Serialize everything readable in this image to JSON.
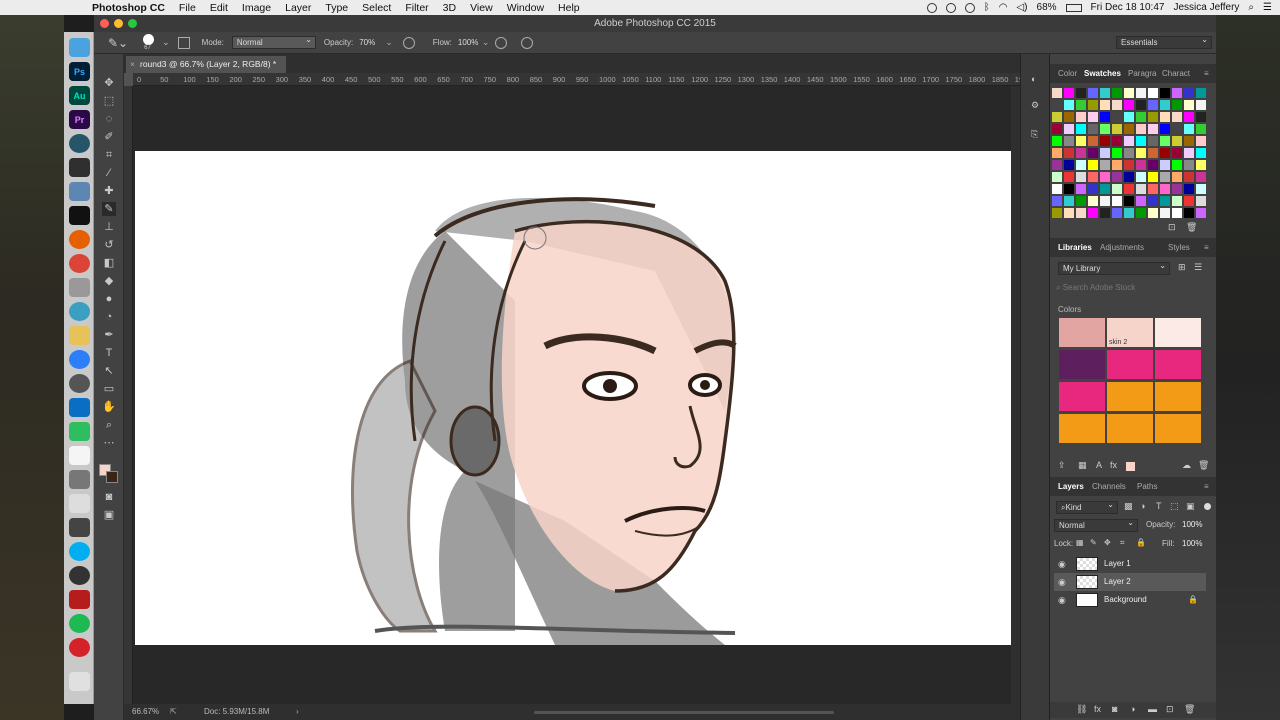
{
  "menubar": {
    "app_name": "Photoshop CC",
    "items": [
      "File",
      "Edit",
      "Image",
      "Layer",
      "Type",
      "Select",
      "Filter",
      "3D",
      "View",
      "Window",
      "Help"
    ],
    "battery": "68%",
    "datetime": "Fri Dec 18  10:47",
    "user": "Jessica Jeffery"
  },
  "window": {
    "title": "Adobe Photoshop CC 2015"
  },
  "options_bar": {
    "brush_size": "67",
    "mode_label": "Mode:",
    "mode_value": "Normal",
    "opacity_label": "Opacity:",
    "opacity_value": "70%",
    "flow_label": "Flow:",
    "flow_value": "100%",
    "workspace": "Essentials"
  },
  "document": {
    "tab_title": "round3 @ 66.7% (Layer 2, RGB/8) *",
    "zoom": "66.67%",
    "doc_info": "Doc: 5.93M/15.8M"
  },
  "ruler_ticks": [
    "0",
    "50",
    "100",
    "150",
    "200",
    "250",
    "300",
    "350",
    "400",
    "450",
    "500",
    "550",
    "600",
    "650",
    "700",
    "750",
    "800",
    "850",
    "900",
    "950",
    "1000",
    "1050",
    "1100",
    "1150",
    "1200",
    "1250",
    "1300",
    "1350",
    "1400",
    "1450",
    "1500",
    "1550",
    "1600",
    "1650",
    "1700",
    "1750",
    "1800",
    "1850",
    "19"
  ],
  "dock_icons": [
    {
      "label": "Ps",
      "color": "#001e36"
    },
    {
      "label": "Au",
      "color": "#00473e"
    },
    {
      "label": "Pr",
      "color": "#2a0a46"
    }
  ],
  "swatches_panel": {
    "tabs": [
      "Color",
      "Swatches",
      "Paragra",
      "Charact"
    ],
    "active": "Swatches"
  },
  "libraries_panel": {
    "tabs": [
      "Libraries",
      "Adjustments",
      "Styles"
    ],
    "library_name": "My Library",
    "search_placeholder": "Search Adobe Stock",
    "colors_heading": "Colors",
    "skin_label": "skin 2"
  },
  "layers_panel": {
    "tabs": [
      "Layers",
      "Channels",
      "Paths"
    ],
    "filter": "Kind",
    "blend_mode": "Normal",
    "opacity_label": "Opacity:",
    "opacity_value": "100%",
    "lock_label": "Lock:",
    "fill_label": "Fill:",
    "fill_value": "100%",
    "layers": [
      "Layer 1",
      "Layer 2",
      "Background"
    ]
  },
  "colors": {
    "accent_pink": "#e8287f",
    "accent_orange": "#f39a16",
    "skin": "#f7d4c9"
  }
}
